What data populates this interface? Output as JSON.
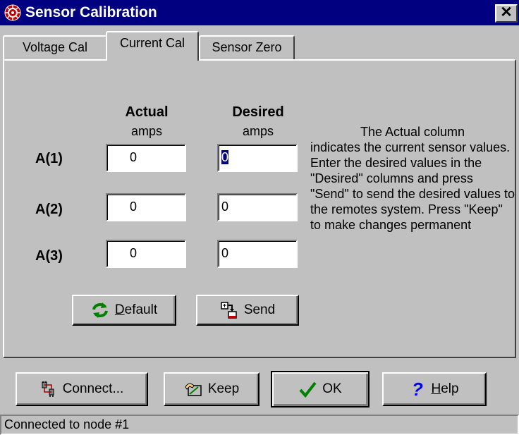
{
  "window": {
    "title": "Sensor Calibration",
    "close_label": "✕"
  },
  "tabs": [
    {
      "label": "Voltage Cal",
      "active": false
    },
    {
      "label": "Current Cal",
      "active": true
    },
    {
      "label": "Sensor Zero",
      "active": false
    }
  ],
  "columns": {
    "actual": {
      "heading": "Actual",
      "unit": "amps"
    },
    "desired": {
      "heading": "Desired",
      "unit": "amps"
    }
  },
  "rows": [
    {
      "label": "A(1)",
      "actual": "0",
      "desired": "0",
      "desired_selected": true
    },
    {
      "label": "A(2)",
      "actual": "0",
      "desired": "0",
      "desired_selected": false
    },
    {
      "label": "A(3)",
      "actual": "0",
      "desired": "0",
      "desired_selected": false
    }
  ],
  "instructions": {
    "first_line": "The Actual column",
    "rest": "indicates the current  sensor values. Enter the desired values in the \"Desired\" columns and press \"Send\" to send the desired values to the remotes system. Press \"Keep\" to make changes permanent"
  },
  "panel_buttons": {
    "default": {
      "accel": "D",
      "rest": "efault",
      "icon": "refresh-icon"
    },
    "send": {
      "label": "Send",
      "icon": "send-icon"
    }
  },
  "bottom_buttons": {
    "connect": {
      "label": "Connect...",
      "icon": "connect-plug-icon"
    },
    "keep": {
      "label": "Keep",
      "icon": "keep-hand-icon"
    },
    "ok": {
      "label": "OK",
      "icon": "checkmark-icon"
    },
    "help": {
      "accel": "H",
      "rest": "elp",
      "icon": "question-mark-icon"
    }
  },
  "status_bar": {
    "text": "Connected to node #1"
  },
  "colors": {
    "titlebar": "#000080",
    "face": "#c0c0c0",
    "selection": "#000080",
    "check": "#008000",
    "help": "#0000ff"
  }
}
